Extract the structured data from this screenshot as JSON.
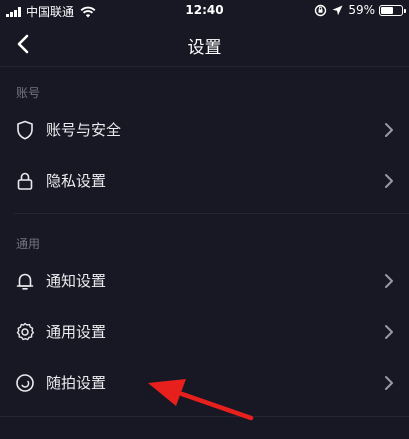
{
  "status_bar": {
    "carrier": "中国联通",
    "time": "12:40",
    "battery_text": "59%",
    "battery_level": 0.59
  },
  "header": {
    "title": "设置"
  },
  "sections": [
    {
      "label": "账号",
      "items": [
        {
          "label": "账号与安全",
          "icon": "shield-icon"
        },
        {
          "label": "隐私设置",
          "icon": "lock-icon"
        }
      ]
    },
    {
      "label": "通用",
      "items": [
        {
          "label": "通知设置",
          "icon": "bell-icon"
        },
        {
          "label": "通用设置",
          "icon": "gear-icon"
        },
        {
          "label": "随拍设置",
          "icon": "camera-circle-icon"
        }
      ]
    }
  ],
  "annotation": {
    "color": "#e8201d",
    "target": "随拍设置"
  },
  "colors": {
    "background": "#181824",
    "divider": "#272733",
    "muted_text": "#737380"
  }
}
